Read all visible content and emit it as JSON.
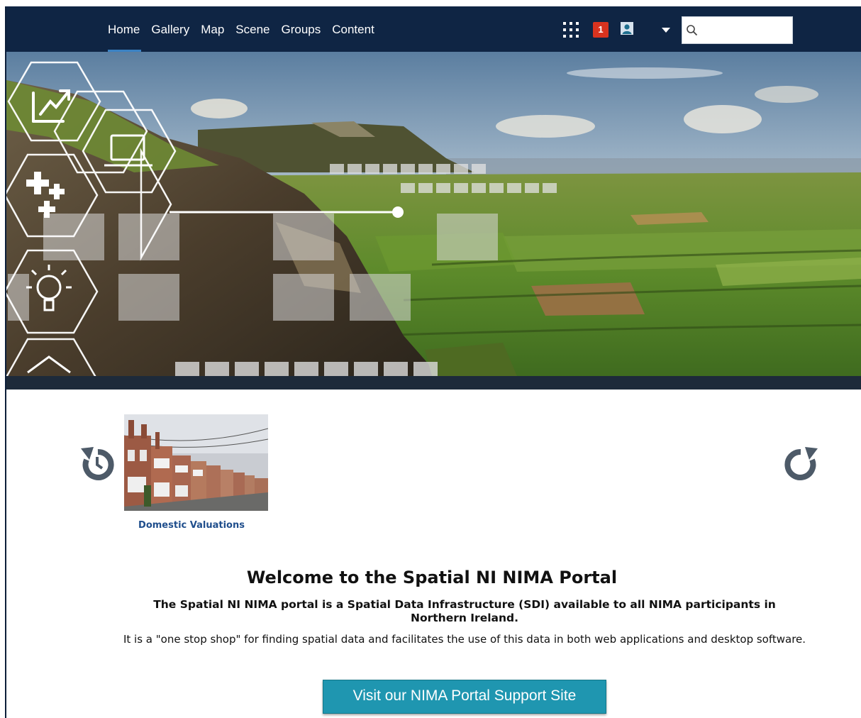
{
  "nav": {
    "items": [
      {
        "label": "Home",
        "active": true
      },
      {
        "label": "Gallery"
      },
      {
        "label": "Map"
      },
      {
        "label": "Scene"
      },
      {
        "label": "Groups"
      },
      {
        "label": "Content"
      }
    ],
    "notification_count": "1",
    "search": {
      "value": "",
      "placeholder": ""
    }
  },
  "icons": {
    "apps": "apps-grid-icon",
    "user": "user-avatar-icon",
    "search": "search-icon",
    "prev": "rotate-left-icon",
    "next": "rotate-right-icon"
  },
  "carousel": {
    "items": [
      {
        "caption": "Domestic Valuations"
      }
    ]
  },
  "welcome": {
    "title": "Welcome to the Spatial NI NIMA Portal",
    "subtitle": "The Spatial NI NIMA portal is a Spatial Data Infrastructure (SDI) available to all NIMA participants in Northern Ireland.",
    "description": "It is a \"one stop shop\" for finding spatial data and facilitates the use of this data in both web applications and desktop software.",
    "button_label": "Visit our NIMA Portal Support Site"
  },
  "colors": {
    "header_bg": "#0f2544",
    "badge": "#d9331f",
    "active_underline": "#3b82c4",
    "button_bg": "#1f96b0",
    "caption_link": "#1f4e8c"
  }
}
